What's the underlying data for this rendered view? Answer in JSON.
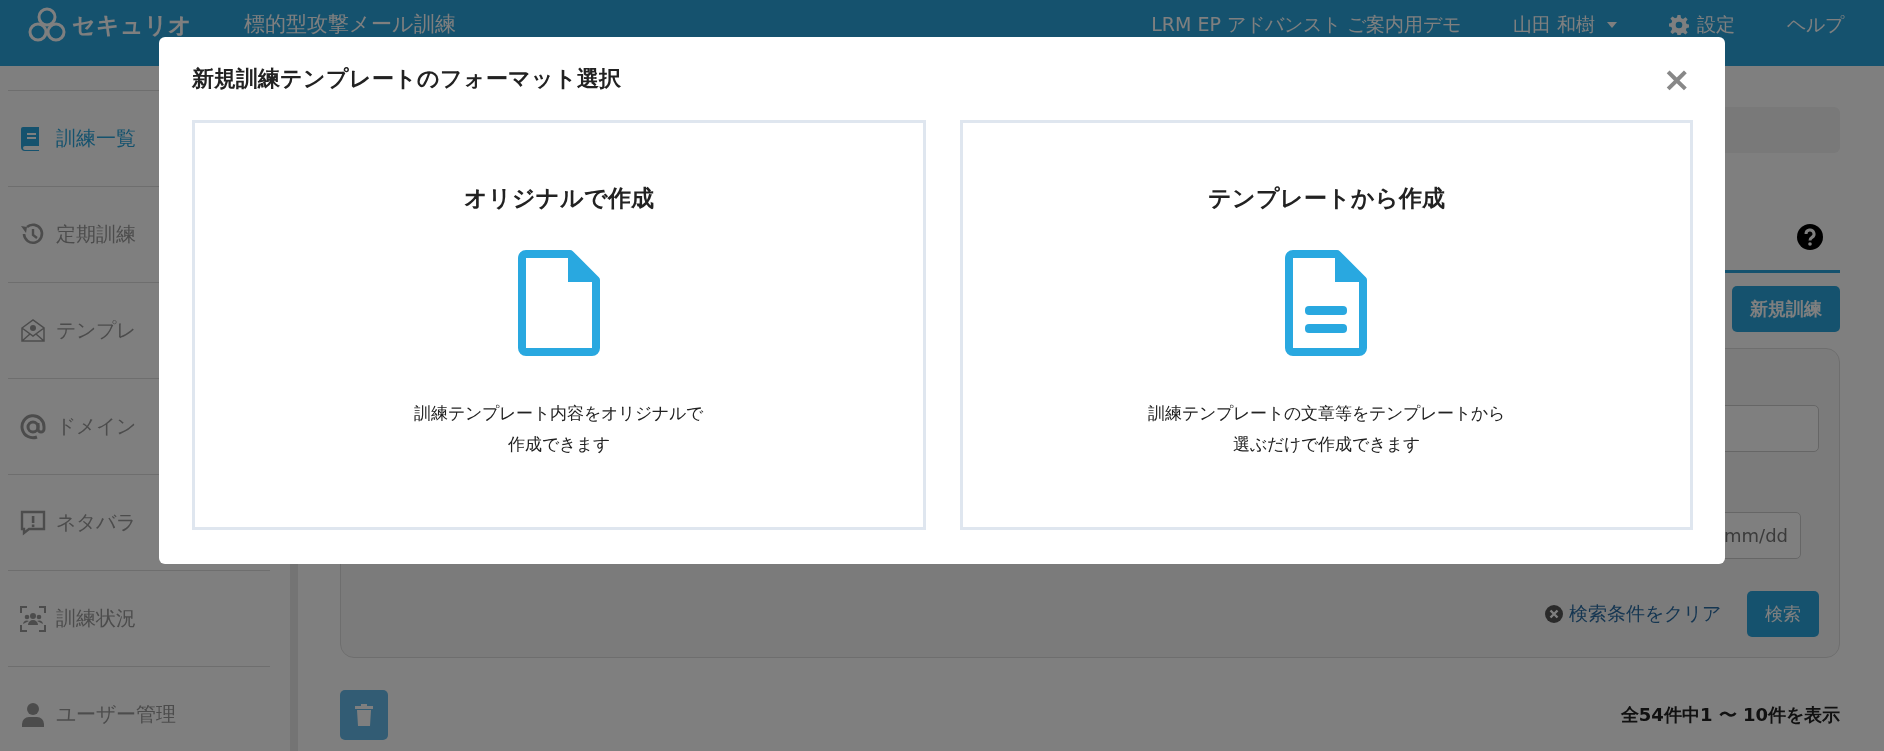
{
  "header": {
    "logo": "セキュリオ",
    "app_title": "標的型攻撃メール訓練",
    "tenant": "LRM EP アドバンスト ご案内用デモ",
    "user": "山田 和樹",
    "settings": "設定",
    "help": "ヘルプ"
  },
  "sidebar": {
    "items": [
      {
        "label": "訓練一覧",
        "selected": true
      },
      {
        "label": "定期訓練",
        "selected": false
      },
      {
        "label": "テンプレ",
        "selected": false
      },
      {
        "label": "ドメイン",
        "selected": false
      },
      {
        "label": "ネタバラ",
        "selected": false
      },
      {
        "label": "訓練状況",
        "selected": false
      },
      {
        "label": "ユーザー管理",
        "selected": false
      }
    ]
  },
  "content": {
    "new_button": "新規訓練",
    "search_panel": {
      "date_placeholder": "mm/dd",
      "clear_link": "検索条件をクリア",
      "search_button": "検索"
    },
    "result_count": "全54件中1 〜 10件を表示"
  },
  "modal": {
    "title": "新規訓練テンプレートのフォーマット選択",
    "close": "×",
    "options": [
      {
        "kind": "blank",
        "title": "オリジナルで作成",
        "description_lines": [
          "訓練テンプレート内容をオリジナルで",
          "作成できます"
        ]
      },
      {
        "kind": "lined",
        "title": "テンプレートから作成",
        "description_lines": [
          "訓練テンプレートの文章等をテンプレートから",
          "選ぶだけで作成できます"
        ]
      }
    ]
  }
}
